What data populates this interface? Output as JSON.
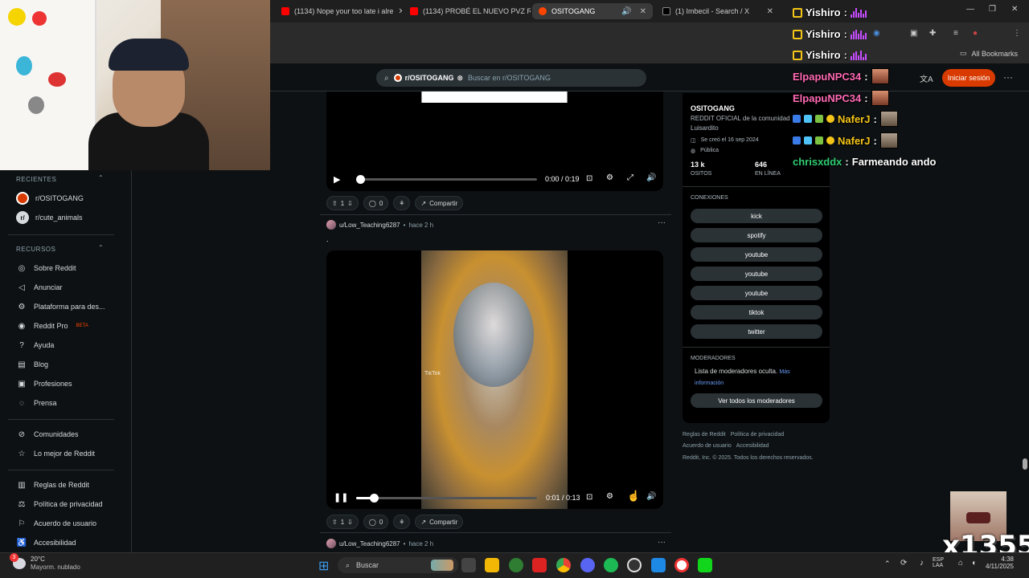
{
  "browser": {
    "tabs": [
      {
        "label": "(1134) Nope your too late i alre",
        "color": "#ff0000",
        "active": false
      },
      {
        "label": "(1134) PROBÉ EL NUEVO PVZ R",
        "color": "#ff0000",
        "active": false
      },
      {
        "label": "OSITOGANG",
        "color": "#ff4500",
        "active": true
      },
      {
        "label": "(1) Imbecil - Search / X",
        "color": "#ffffff",
        "active": false
      }
    ],
    "bookmarks_label": "All Bookmarks"
  },
  "reddit_header": {
    "community_chip": "r/OSITOGANG",
    "search_placeholder": "Buscar en r/OSITOGANG",
    "login_label": "Iniciar sesión",
    "menu_glyph": "···"
  },
  "sidebar": {
    "recent_title": "RECIENTES",
    "recent": [
      {
        "label": "r/OSITOGANG"
      },
      {
        "label": "r/cute_animals"
      }
    ],
    "resources_title": "RECURSOS",
    "resources": [
      {
        "label": "Sobre Reddit",
        "icon": "reddit-icon"
      },
      {
        "label": "Anunciar",
        "icon": "megaphone-icon"
      },
      {
        "label": "Plataforma para des...",
        "icon": "gear-icon"
      },
      {
        "label": "Reddit Pro",
        "icon": "pro-icon",
        "badge": "BETA"
      },
      {
        "label": "Ayuda",
        "icon": "help-icon"
      },
      {
        "label": "Blog",
        "icon": "book-icon"
      },
      {
        "label": "Profesiones",
        "icon": "briefcase-icon"
      },
      {
        "label": "Prensa",
        "icon": "mic-icon"
      }
    ],
    "communities": [
      {
        "label": "Comunidades",
        "icon": "communities-icon"
      },
      {
        "label": "Lo mejor de Reddit",
        "icon": "star-icon"
      }
    ],
    "policies": [
      {
        "label": "Reglas de Reddit",
        "icon": "rules-icon"
      },
      {
        "label": "Política de privacidad",
        "icon": "privacy-icon"
      },
      {
        "label": "Acuerdo de usuario",
        "icon": "agreement-icon"
      },
      {
        "label": "Accesibilidad",
        "icon": "accessibility-icon"
      }
    ]
  },
  "feed": {
    "post1": {
      "time": "0:00 / 0:19",
      "progress": 0.0,
      "votes": "1",
      "comments": "0",
      "share": "Compartir"
    },
    "post2": {
      "author": "u/Low_Teaching6287",
      "age": "hace 2 h",
      "title": ".",
      "watermark": "TikTok",
      "time": "0:01 / 0:13",
      "progress": 0.077,
      "votes": "1",
      "comments": "0",
      "share": "Compartir"
    },
    "post3": {
      "author": "u/Low_Teaching6287",
      "age": "hace 2 h"
    }
  },
  "community": {
    "name": "OSITOGANG",
    "description": "REDDIT OFICIAL de la comunidad Luisardito",
    "created": "Se creó el 16 sep 2024",
    "visibility": "Pública",
    "members_value": "13 k",
    "members_label": "OSITOS",
    "online_value": "646",
    "online_label": "EN LÍNEA",
    "connections_title": "CONEXIONES",
    "connections": [
      "kick",
      "spotify",
      "youtube",
      "youtube",
      "youtube",
      "tiktok",
      "twitter"
    ],
    "moderators_title": "MODERADORES",
    "moderators_text": "Lista de moderadores oculta.",
    "moderators_link": "Más información",
    "moderators_button": "Ver todos los moderadores",
    "footer": {
      "line1a": "Reglas de Reddit",
      "line1b": "Política de privacidad",
      "line2a": "Acuerdo de usuario",
      "line2b": "Accesibilidad",
      "line3": "Reddit, Inc. © 2025. Todos los derechos reservados."
    }
  },
  "chat": [
    {
      "user": "Yishiro",
      "color": "#ffffff",
      "message": ""
    },
    {
      "user": "Yishiro",
      "color": "#ffffff",
      "message": ""
    },
    {
      "user": "Yishiro",
      "color": "#ffffff",
      "message": ""
    },
    {
      "user": "ElpapuNPC34",
      "color": "#ff69b4",
      "message": ""
    },
    {
      "user": "ElpapuNPC34",
      "color": "#ff69b4",
      "message": ""
    },
    {
      "user": "NaferJ",
      "color": "#f5c518",
      "message": ""
    },
    {
      "user": "NaferJ",
      "color": "#f5c518",
      "message": ""
    },
    {
      "user": "chrisxddx",
      "color": "#2ecc71",
      "message": "Farmeando ando"
    }
  ],
  "overlay": {
    "counter": "x1355"
  },
  "taskbar": {
    "weather_temp": "20°C",
    "weather_desc": "Mayorm. nublado",
    "search_label": "Buscar",
    "lang_top": "ESP",
    "lang_bottom": "LAA",
    "time": "4:38",
    "date": "4/11/2025",
    "notif_count": "3"
  }
}
